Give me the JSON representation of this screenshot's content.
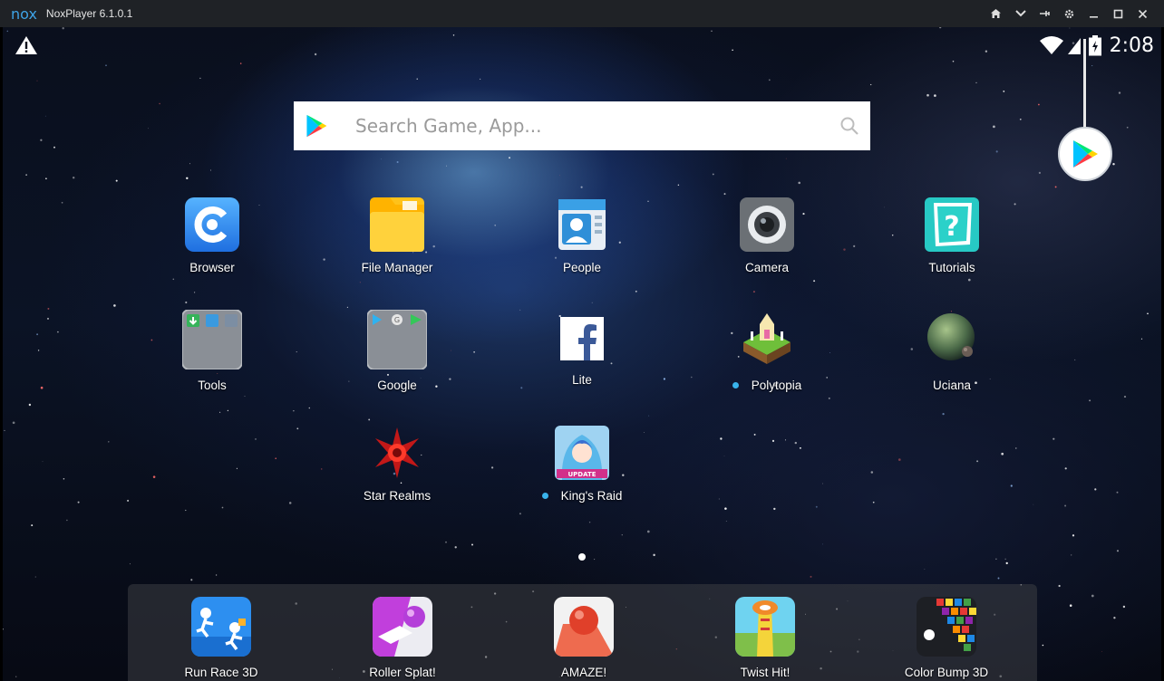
{
  "window": {
    "logo": "nox",
    "title": "NoxPlayer 6.1.0.1",
    "controls": [
      "home-icon",
      "chevron-down-icon",
      "pin-icon",
      "gear-icon",
      "minimize-icon",
      "maximize-icon",
      "close-icon"
    ]
  },
  "status_bar": {
    "time": "2:08",
    "icons": [
      "warning-icon",
      "wifi-icon",
      "signal-icon",
      "battery-icon"
    ]
  },
  "search": {
    "placeholder": "Search Game, App..."
  },
  "apps": [
    {
      "label": "Browser",
      "icon": "browser-icon",
      "new": false
    },
    {
      "label": "File Manager",
      "icon": "folder-icon",
      "new": false
    },
    {
      "label": "People",
      "icon": "contacts-icon",
      "new": false
    },
    {
      "label": "Camera",
      "icon": "camera-icon",
      "new": false
    },
    {
      "label": "Tutorials",
      "icon": "help-icon",
      "new": false
    },
    {
      "label": "Tools",
      "icon": "tools-folder-icon",
      "new": false
    },
    {
      "label": "Google",
      "icon": "google-folder-icon",
      "new": false
    },
    {
      "label": "Lite",
      "icon": "facebook-icon",
      "new": false
    },
    {
      "label": "Polytopia",
      "icon": "polytopia-icon",
      "new": true
    },
    {
      "label": "Uciana",
      "icon": "planet-icon",
      "new": false
    },
    {
      "label": "Star Realms",
      "icon": "star-realms-icon",
      "new": false
    },
    {
      "label": "King's Raid",
      "icon": "kings-raid-icon",
      "new": true
    }
  ],
  "dock": [
    {
      "label": "Run Race 3D",
      "icon": "run-race-icon"
    },
    {
      "label": "Roller Splat!",
      "icon": "roller-splat-icon"
    },
    {
      "label": "AMAZE!",
      "icon": "amaze-icon"
    },
    {
      "label": "Twist Hit!",
      "icon": "twist-hit-icon"
    },
    {
      "label": "Color Bump 3D",
      "icon": "color-bump-icon"
    }
  ],
  "colors": {
    "titlebar": "#1f2226",
    "accent": "#3ea3e6",
    "new_dot": "#39b3ec"
  }
}
